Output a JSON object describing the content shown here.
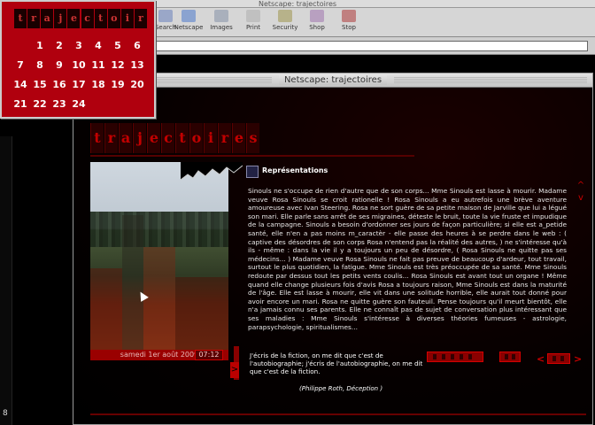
{
  "back_window": {
    "title": "Netscape: trajectoires",
    "toolbar": [
      {
        "label": "Search",
        "icon": "search-icon"
      },
      {
        "label": "Netscape",
        "icon": "netscape-icon"
      },
      {
        "label": "Images",
        "icon": "images-icon"
      },
      {
        "label": "Print",
        "icon": "print-icon"
      },
      {
        "label": "Security",
        "icon": "security-icon"
      },
      {
        "label": "Shop",
        "icon": "shop-icon"
      },
      {
        "label": "Stop",
        "icon": "stop-icon"
      }
    ],
    "side_glyph": "8"
  },
  "calendar": {
    "header_letters": [
      "t",
      "r",
      "a",
      "j",
      "e",
      "c",
      "t",
      "o",
      "i",
      "r",
      "e",
      "s"
    ],
    "days": [
      "1",
      "2",
      "3",
      "4",
      "5",
      "6",
      "7",
      "8",
      "9",
      "10",
      "11",
      "12",
      "13",
      "14",
      "15",
      "16",
      "17",
      "18",
      "19",
      "20",
      "21",
      "22",
      "23",
      "24"
    ],
    "leading_blanks": 1
  },
  "front_window": {
    "title": "Netscape: trajectoires",
    "logo_letters": [
      "t",
      "r",
      "a",
      "j",
      "e",
      "c",
      "t",
      "o",
      "i",
      "r",
      "e",
      "s"
    ],
    "section_title": "Représentations",
    "body": "Sinouls ne s'occupe de rien d'autre que de son corps... Mme Sinouls est lasse à mourir. Madame veuve Rosa Sinouls se croit rationelle ! Rosa Sinouls a eu autrefois une brève aventure amoureuse avec Ivan Steering. Rosa ne sort guère de sa petite maison de Jarville que lui a légué son mari. Elle parle sans arrêt de ses migraines, déteste le bruit, toute la vie fruste et impudique de la campagne. Sinouls a besoin d'ordonner ses jours de façon particulière; si elle est a_petide santé, elle n'en a pas moins m_caractèr - elle passe des heures à se perdre dans le web : ( captive des désordres de son corps Rosa n'entend pas la réalité des autres, ) ne s'intéresse qu'à ils - même : dans la vie il y a toujours un peu de désordre, ( Rosa Sinouls ne quitte pas ses médecins... ) Madame veuve Rosa Sinouls ne fait pas preuve de beaucoup d'ardeur, tout travail, surtout le plus quotidien, la fatigue. Mme Sinouls est très préoccupée de sa santé. Mme Sinouls redoute par dessus tout les petits vents coulis... Rosa Sinouls est avant tout un organe ! Même quand elle change plusieurs fois d'avis Rosa a toujours raison, Mme Sinouls est dans la maturité de l'âge. Elle est lasse à mourir, elle vit dans une solitude horrible, elle aurait tout donné pour avoir encore un mari. Rosa ne quitte guère son fauteuil. Pense toujours qu'il meurt bientôt, elle n'a jamais connu ses parents. Elle ne connaît pas de sujet de conversation plus intéressant que ses maladies : Mme Sinouls s'intéresse à diverses théories fumeuses - astrologie, parapsychologie, spiritualismes...",
    "date": "samedi 1er août 2009",
    "time": "07:12",
    "quote": "J'écris de la fiction, on me dit que c'est de l'autobiographie; j'écris de l'autobiographie, on me dit que c'est de la fiction.",
    "quote_source": "(Philippe Roth, Déception )",
    "arrows": {
      "up": "^",
      "down": "v",
      "left": "<",
      "right": ">"
    }
  },
  "colors": {
    "accent_red": "#b0000e",
    "dark_red": "#2a0000",
    "text": "#e8e8e8"
  }
}
